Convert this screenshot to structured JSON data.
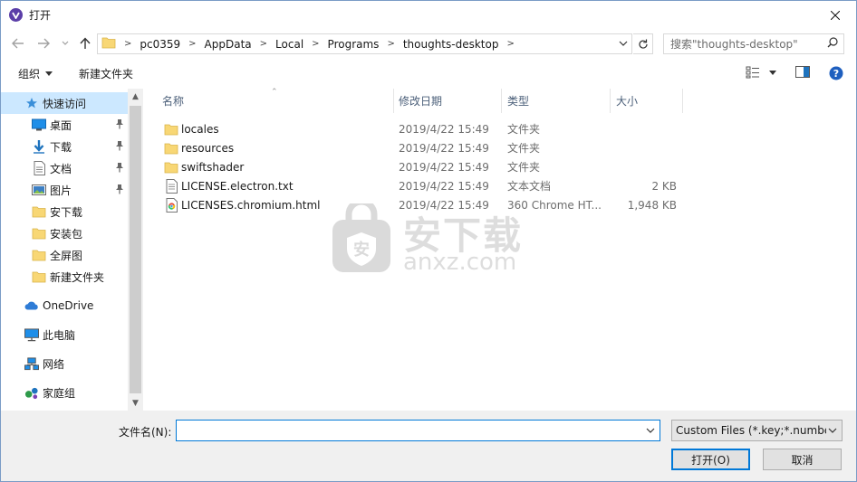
{
  "window": {
    "title": "打开",
    "colors": {
      "accent": "#0078d7",
      "selection": "#cce8ff",
      "folder": "#f8d775"
    }
  },
  "address": {
    "crumbs": [
      "pc0359",
      "AppData",
      "Local",
      "Programs",
      "thoughts-desktop"
    ],
    "search_placeholder": "搜索\"thoughts-desktop\""
  },
  "toolbar": {
    "organize_label": "组织",
    "new_folder_label": "新建文件夹"
  },
  "navpane": {
    "items": [
      {
        "label": "快速访问",
        "icon": "star-icon",
        "selected": true,
        "pinned": false
      },
      {
        "label": "桌面",
        "icon": "desktop-icon",
        "selected": false,
        "pinned": true
      },
      {
        "label": "下载",
        "icon": "download-icon",
        "selected": false,
        "pinned": true
      },
      {
        "label": "文档",
        "icon": "document-icon",
        "selected": false,
        "pinned": true
      },
      {
        "label": "图片",
        "icon": "pictures-icon",
        "selected": false,
        "pinned": true
      },
      {
        "label": "安下载",
        "icon": "folder-icon",
        "selected": false,
        "pinned": false
      },
      {
        "label": "安装包",
        "icon": "folder-icon",
        "selected": false,
        "pinned": false
      },
      {
        "label": "全屏图",
        "icon": "folder-icon",
        "selected": false,
        "pinned": false
      },
      {
        "label": "新建文件夹",
        "icon": "folder-icon",
        "selected": false,
        "pinned": false
      },
      {
        "label": "OneDrive",
        "icon": "cloud-icon",
        "selected": false,
        "pinned": false
      },
      {
        "label": "此电脑",
        "icon": "computer-icon",
        "selected": false,
        "pinned": false
      },
      {
        "label": "网络",
        "icon": "network-icon",
        "selected": false,
        "pinned": false
      },
      {
        "label": "家庭组",
        "icon": "homegroup-icon",
        "selected": false,
        "pinned": false
      }
    ]
  },
  "filelist": {
    "columns": {
      "name": "名称",
      "date": "修改日期",
      "type": "类型",
      "size": "大小"
    },
    "rows": [
      {
        "name": "locales",
        "date": "2019/4/22 15:49",
        "type": "文件夹",
        "size": "",
        "icon": "folder-icon"
      },
      {
        "name": "resources",
        "date": "2019/4/22 15:49",
        "type": "文件夹",
        "size": "",
        "icon": "folder-icon"
      },
      {
        "name": "swiftshader",
        "date": "2019/4/22 15:49",
        "type": "文件夹",
        "size": "",
        "icon": "folder-icon"
      },
      {
        "name": "LICENSE.electron.txt",
        "date": "2019/4/22 15:49",
        "type": "文本文档",
        "size": "2 KB",
        "icon": "text-file-icon"
      },
      {
        "name": "LICENSES.chromium.html",
        "date": "2019/4/22 15:49",
        "type": "360 Chrome HT...",
        "size": "1,948 KB",
        "icon": "browser-file-icon"
      }
    ]
  },
  "watermark": {
    "cn": "安下载",
    "en": "anxz.com"
  },
  "bottom": {
    "filename_label": "文件名(N):",
    "filename_value": "",
    "filter_value": "Custom Files (*.key;*.number",
    "open_label": "打开(O)",
    "cancel_label": "取消"
  }
}
